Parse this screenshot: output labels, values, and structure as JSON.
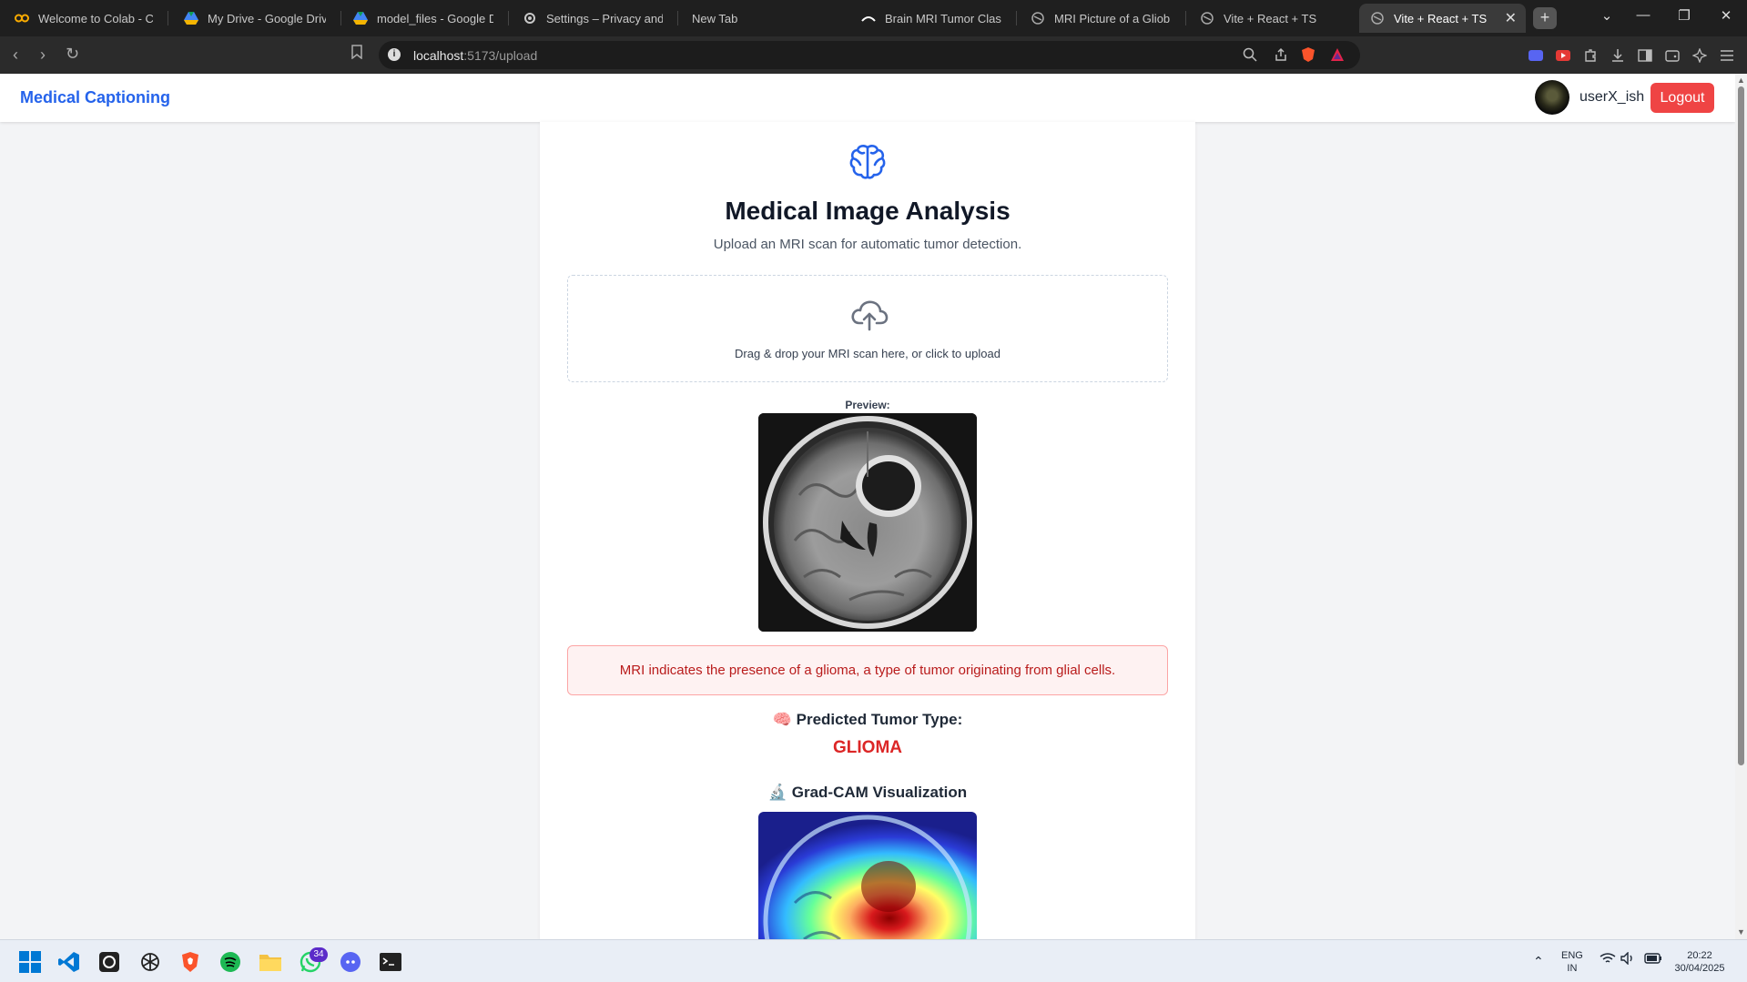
{
  "browser": {
    "tabs": [
      {
        "title": "Welcome to Colab - Colab",
        "icon": "colab-icon"
      },
      {
        "title": "My Drive - Google Drive",
        "icon": "drive-icon"
      },
      {
        "title": "model_files - Google Drive",
        "icon": "drive-icon"
      },
      {
        "title": "Settings – Privacy and security",
        "icon": "settings-icon"
      },
      {
        "title": "New Tab",
        "icon": ""
      },
      {
        "title": "Brain MRI Tumor Classifier",
        "icon": "hf-icon"
      },
      {
        "title": "MRI Picture of a Glioblastoma",
        "icon": "globe-icon"
      },
      {
        "title": "Vite + React + TS",
        "icon": "globe-icon"
      },
      {
        "title": "Vite + React + TS",
        "icon": "globe-icon",
        "active": true
      }
    ],
    "url": {
      "host": "localhost",
      "path": ":5173/upload"
    }
  },
  "app": {
    "brand": "Medical Captioning",
    "user": {
      "name": "userX_ish"
    },
    "logout_label": "Logout",
    "accent_color": "#2563eb",
    "danger_color": "#ef4444"
  },
  "card": {
    "title": "Medical Image Analysis",
    "subtitle": "Upload an MRI scan for automatic tumor detection.",
    "dropzone_text": "Drag & drop your MRI scan here, or click to upload",
    "preview_label": "Preview:",
    "alert_text": "MRI indicates the presence of a glioma, a type of tumor originating from glial cells.",
    "prediction_label": "🧠 Predicted Tumor Type:",
    "prediction_value": "GLIOMA",
    "gradcam_label": "🔬 Grad-CAM Visualization"
  },
  "taskbar": {
    "apps": [
      "windows-start-icon",
      "vscode-icon",
      "github-icon",
      "chatgpt-icon",
      "brave-icon",
      "spotify-icon",
      "file-explorer-icon",
      "whatsapp-icon",
      "discord-icon",
      "terminal-icon"
    ],
    "whatsapp_badge": "34",
    "lang": "ENG",
    "region": "IN",
    "time": "20:22",
    "date": "30/04/2025"
  }
}
